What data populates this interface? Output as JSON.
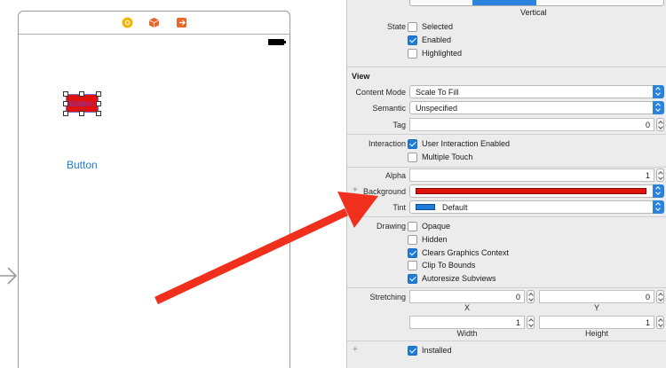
{
  "canvas": {
    "button_title_selected": "Button",
    "button_title": "Button",
    "colors": {
      "selected_button_bg": "#e0120e",
      "system_blue": "#1d7ad6",
      "annotation_arrow": "#f0301c"
    },
    "dock_icons": [
      "view-controller-icon",
      "first-responder-icon",
      "exit-icon"
    ]
  },
  "inspector": {
    "axis_selected_label": "Vertical",
    "state": {
      "label": "State",
      "selected": {
        "label": "Selected",
        "checked": false
      },
      "enabled": {
        "label": "Enabled",
        "checked": true
      },
      "highlighted": {
        "label": "Highlighted",
        "checked": false
      }
    },
    "view": {
      "title": "View",
      "content_mode": {
        "label": "Content Mode",
        "value": "Scale To Fill"
      },
      "semantic": {
        "label": "Semantic",
        "value": "Unspecified"
      },
      "tag": {
        "label": "Tag",
        "value": "0"
      },
      "interaction": {
        "label": "Interaction",
        "user_interaction": {
          "label": "User Interaction Enabled",
          "checked": true
        },
        "multiple_touch": {
          "label": "Multiple Touch",
          "checked": false
        }
      },
      "alpha": {
        "label": "Alpha",
        "value": "1"
      },
      "background": {
        "label": "Background",
        "color": "#e0120e"
      },
      "tint": {
        "label": "Tint",
        "value": "Default",
        "color": "#1e7bd7"
      },
      "drawing": {
        "label": "Drawing",
        "opaque": {
          "label": "Opaque",
          "checked": false
        },
        "hidden": {
          "label": "Hidden",
          "checked": false
        },
        "clears_graphics": {
          "label": "Clears Graphics Context",
          "checked": true
        },
        "clip_to_bounds": {
          "label": "Clip To Bounds",
          "checked": false
        },
        "autoresize": {
          "label": "Autoresize Subviews",
          "checked": true
        }
      },
      "stretching": {
        "label": "Stretching",
        "x": {
          "value": "0",
          "caption": "X"
        },
        "y": {
          "value": "0",
          "caption": "Y"
        },
        "width": {
          "value": "1",
          "caption": "Width"
        },
        "height": {
          "value": "1",
          "caption": "Height"
        }
      },
      "installed": {
        "label": "Installed",
        "checked": true
      }
    }
  }
}
